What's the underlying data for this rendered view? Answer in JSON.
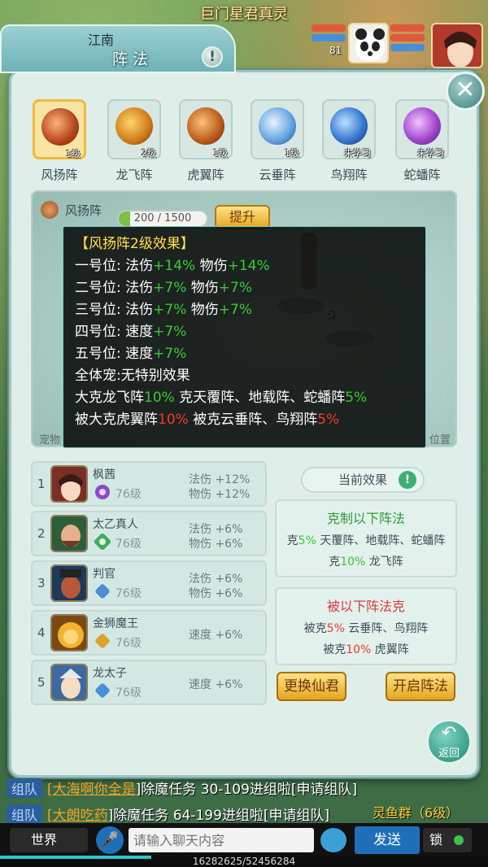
{
  "top_title": "巨门星君真灵",
  "header": {
    "region": "江南",
    "title": "阵法",
    "help": "!",
    "level": "81"
  },
  "formations": [
    {
      "name": "风扬阵",
      "status": "1级"
    },
    {
      "name": "龙飞阵",
      "status": "2级"
    },
    {
      "name": "虎翼阵",
      "status": "1级"
    },
    {
      "name": "云垂阵",
      "status": "1级"
    },
    {
      "name": "鸟翔阵",
      "status": "未学习"
    },
    {
      "name": "蛇蟠阵",
      "status": "未学习"
    }
  ],
  "selected": {
    "name": "风扬阵",
    "progress_text": "200 / 1500",
    "progress_fraction": 0.133,
    "upgrade": "提升",
    "stage_pet_label": "宠物",
    "stage_position_label": "位置",
    "stage_slot": "5"
  },
  "tooltip": {
    "title": "【风扬阵2级效果】",
    "lines": [
      {
        "label": "一号位: 法伤",
        "v1": "+14%",
        "mid": " 物伤",
        "v2": "+14%"
      },
      {
        "label": "二号位: 法伤",
        "v1": "+7%",
        "mid": " 物伤",
        "v2": "+7%"
      },
      {
        "label": "三号位: 法伤",
        "v1": "+7%",
        "mid": " 物伤",
        "v2": "+7%"
      },
      {
        "label": "四号位: 速度",
        "v1": "+7%",
        "mid": "",
        "v2": ""
      },
      {
        "label": "五号位: 速度",
        "v1": "+7%",
        "mid": "",
        "v2": ""
      }
    ],
    "pet_line": "全体宠:无特别效果",
    "counter_prefix": "大克龙飞阵",
    "counter_v1": "10%",
    "counter_mid": " 克天覆阵、地载阵、蛇蟠阵",
    "counter_v2": "5%",
    "countered_prefix": "被大克虎翼阵",
    "countered_v1": "10%",
    "countered_mid": " 被克云垂阵、鸟翔阵",
    "countered_v2": "5%"
  },
  "members": [
    {
      "idx": "1",
      "name": "枫茜",
      "level": "76级",
      "eff1": "法伤 +12%",
      "eff2": "物伤 +12%"
    },
    {
      "idx": "2",
      "name": "太乙真人",
      "level": "76级",
      "eff1": "法伤 +6%",
      "eff2": "物伤 +6%"
    },
    {
      "idx": "3",
      "name": "判官",
      "level": "76级",
      "eff1": "法伤 +6%",
      "eff2": "物伤 +6%"
    },
    {
      "idx": "4",
      "name": "金狮魔王",
      "level": "76级",
      "eff1": "速度 +6%",
      "eff2": ""
    },
    {
      "idx": "5",
      "name": "龙太子",
      "level": "76级",
      "eff1": "速度 +6%",
      "eff2": ""
    }
  ],
  "current_effect": {
    "label": "当前效果",
    "help": "!",
    "counter_head": "克制以下阵法",
    "counter_l1_pre": "克",
    "counter_l1_v": "5%",
    "counter_l1_post": " 天覆阵、地载阵、蛇蟠阵",
    "counter_l2_pre": "克",
    "counter_l2_v": "10%",
    "counter_l2_post": " 龙飞阵",
    "countered_head": "被以下阵法克",
    "countered_l1_pre": "被克",
    "countered_l1_v": "5%",
    "countered_l1_post": " 云垂阵、鸟翔阵",
    "countered_l2_pre": "被克",
    "countered_l2_v": "10%",
    "countered_l2_post": " 虎翼阵"
  },
  "buttons": {
    "change": "更换仙君",
    "open": "开启阵法",
    "back": "返回"
  },
  "chat": [
    {
      "tag": "组队",
      "name": "[大海啊你全是",
      "msg": "]除魔任务 30-109进组啦[申请组队]"
    },
    {
      "tag": "组队",
      "name": "[大朗吃药",
      "msg": "]除魔任务 64-199进组啦[申请组队]"
    }
  ],
  "fish_tag": "灵鱼群（6级）",
  "bottom": {
    "world": "世界",
    "input_placeholder": "请输入聊天内容",
    "send": "发送",
    "lock": "锁",
    "xp_text": "16282625/52456284",
    "xp_fraction": 0.31
  },
  "colors": {
    "green": "#37c938",
    "red": "#f23a2a",
    "gold": "#f0b93a"
  }
}
